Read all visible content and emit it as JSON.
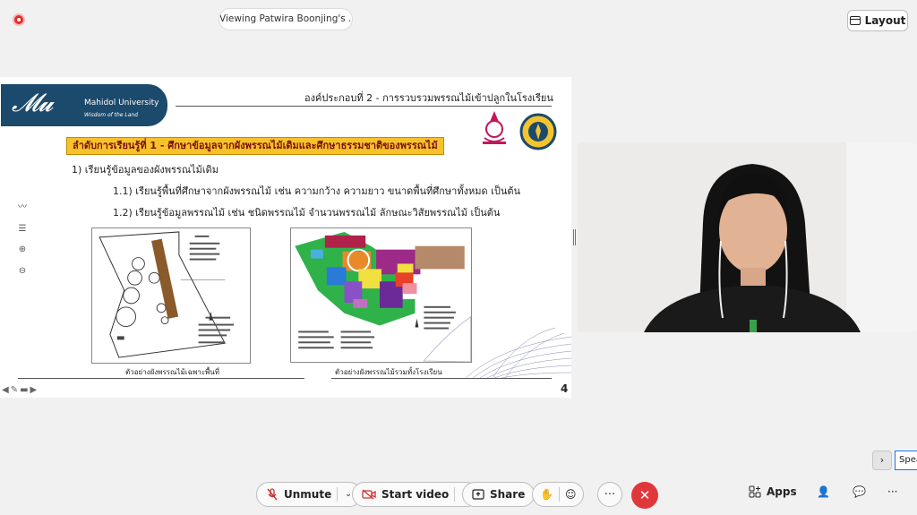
{
  "top": {
    "viewing_label": "Viewing Patwira Boonjing's ...",
    "layout_label": "Layout"
  },
  "slide": {
    "university_name": "Mahidol University",
    "university_tagline": "Wisdom of the Land",
    "header": "องค์ประกอบที่ 2 - การรวบรวมพรรณไม้เข้าปลูกในโรงเรียน",
    "step_title": "ลำดับการเรียนรู้ที่ 1 - ศึกษาข้อมูลจากผังพรรณไม้เดิมและศึกษาธรรมชาติของพรรณไม้",
    "point1": "1) เรียนรู้ข้อมูลของผังพรรณไม้เดิม",
    "point1_1": "1.1) เรียนรู้พื้นที่ศึกษาจากผังพรรณไม้ เช่น ความกว้าง ความยาว ขนาดพื้นที่ศึกษาทั้งหมด เป็นต้น",
    "point1_2": "1.2) เรียนรู้ข้อมูลพรรณไม้ เช่น ชนิดพรรณไม้ จำนวนพรรณไม้ ลักษณะวิสัยพรรณไม้ เป็นต้น",
    "caption1": "ตัวอย่างผังพรรณไม้เฉพาะพื้นที่",
    "caption2": "ตัวอย่างผังพรรณไม้รวมทั้งโรงเรียน",
    "page_number": "4"
  },
  "controls": {
    "unmute": "Unmute",
    "start_video": "Start video",
    "share": "Share",
    "apps": "Apps",
    "speaker_chip": "Spea"
  },
  "colors": {
    "brand_blue": "#1c4a6c",
    "banner_yellow": "#f6c22a",
    "leave_red": "#e0383a"
  }
}
